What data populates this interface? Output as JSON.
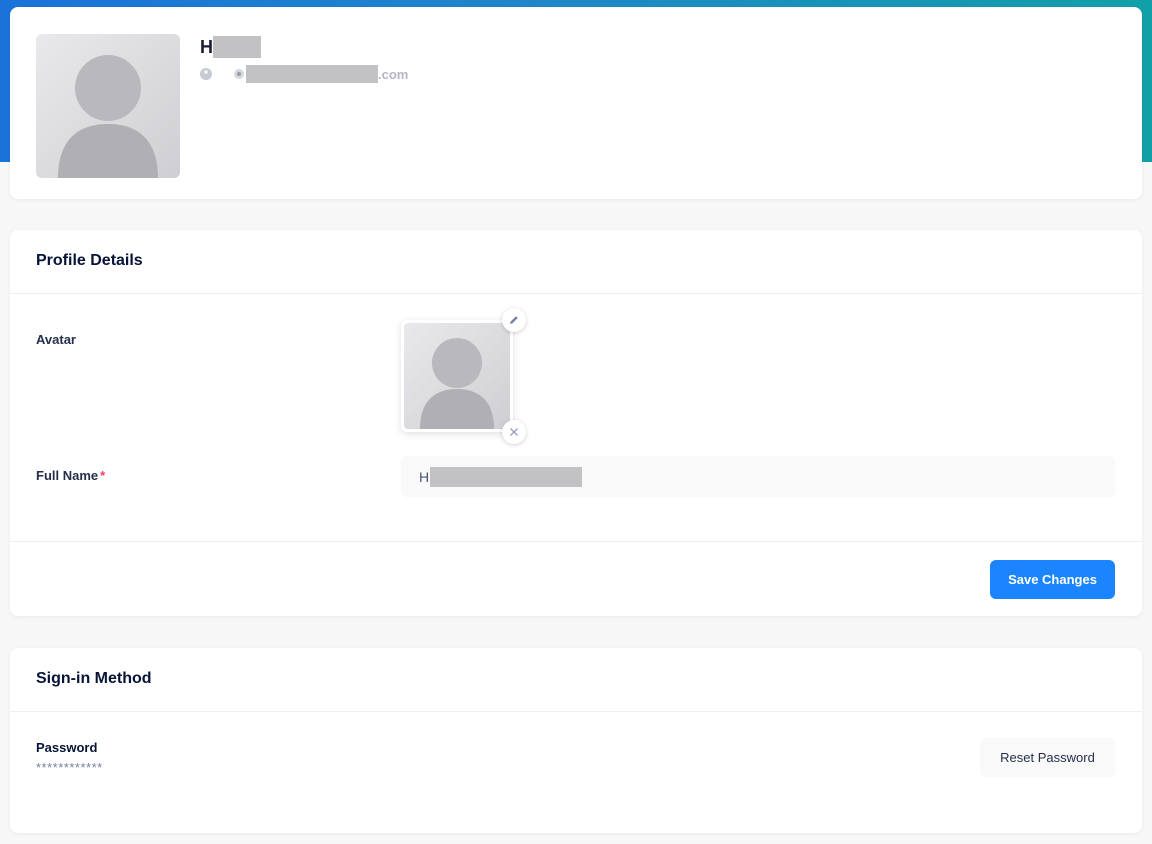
{
  "header": {
    "name_initial": "H",
    "email_suffix": ".com"
  },
  "profile_details": {
    "title": "Profile Details",
    "avatar_label": "Avatar",
    "edit_icon": "pencil-icon",
    "remove_icon": "close-icon",
    "full_name_label": "Full Name",
    "required_mark": "*",
    "full_name_value_initial": "H",
    "save_label": "Save Changes"
  },
  "signin": {
    "title": "Sign-in Method",
    "password_label": "Password",
    "password_mask": "************",
    "reset_label": "Reset Password"
  },
  "colors": {
    "primary": "#1b84ff",
    "required": "#f1416c",
    "hero_start": "#1a73d9",
    "hero_end": "#12a0a8"
  }
}
